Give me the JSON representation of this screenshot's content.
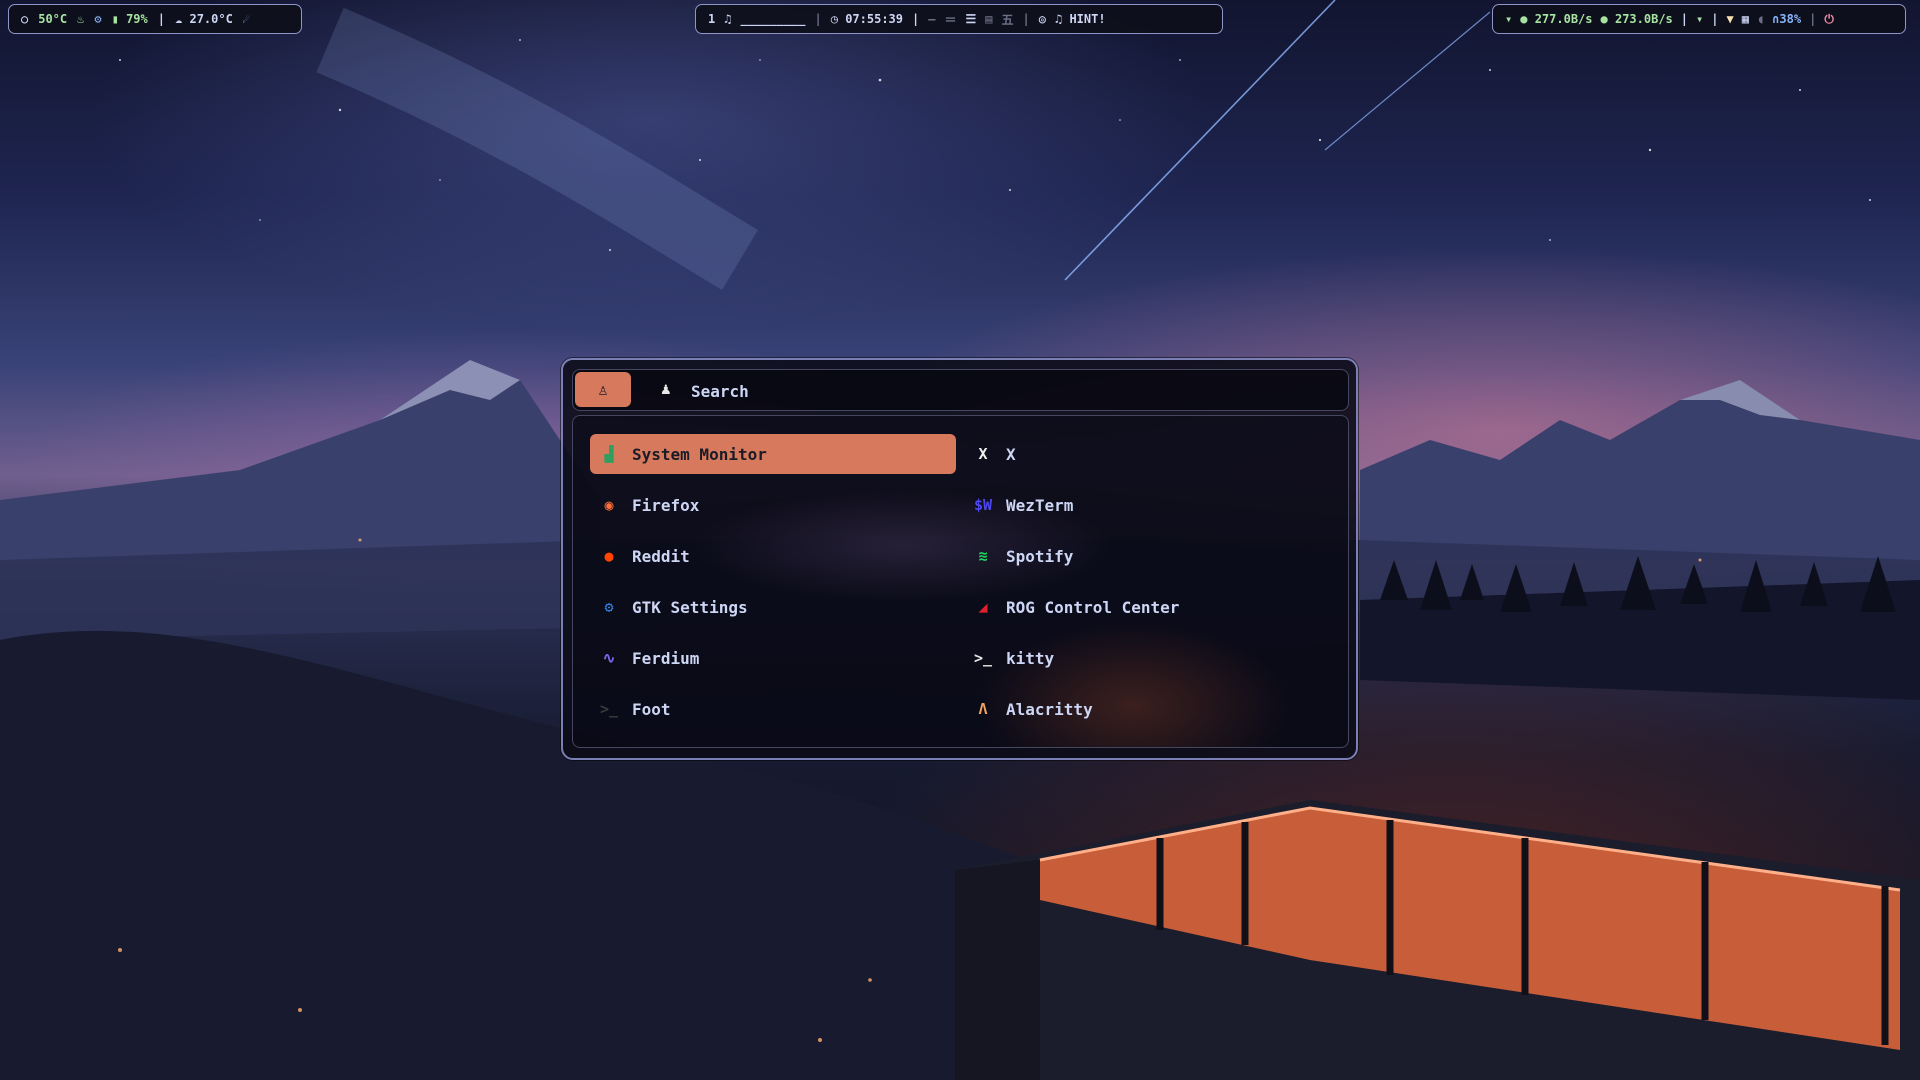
{
  "topbar": {
    "left": {
      "cpu_temp": "50°C",
      "battery": "79%",
      "weather_temp": "27.0°C"
    },
    "center": {
      "workspace": "1",
      "underline": "_________",
      "clock": "07:55:39",
      "hint": "HINT!"
    },
    "right": {
      "download": "277.0B/s",
      "upload": "273.0B/s",
      "volume": "38%"
    }
  },
  "launcher": {
    "search_label": "Search",
    "apps": [
      {
        "label": "System Monitor",
        "icon": "system-monitor-icon",
        "color": "#2e9f5f",
        "glyph": "▟",
        "active": true
      },
      {
        "label": "X",
        "icon": "x-icon",
        "color": "#f2f2f2",
        "glyph": "X",
        "active": false
      },
      {
        "label": "Firefox",
        "icon": "firefox-icon",
        "color": "#ff7139",
        "glyph": "◉",
        "active": false
      },
      {
        "label": "WezTerm",
        "icon": "wezterm-icon",
        "color": "#4e49ee",
        "glyph": "$W",
        "active": false
      },
      {
        "label": "Reddit",
        "icon": "reddit-icon",
        "color": "#ff4500",
        "glyph": "●",
        "active": false
      },
      {
        "label": "Spotify",
        "icon": "spotify-icon",
        "color": "#1ed760",
        "glyph": "≋",
        "active": false
      },
      {
        "label": "GTK Settings",
        "icon": "gtk-settings-icon",
        "color": "#3584e4",
        "glyph": "⚙",
        "active": false
      },
      {
        "label": "ROG Control Center",
        "icon": "rog-icon",
        "color": "#e0212b",
        "glyph": "◢",
        "active": false
      },
      {
        "label": "Ferdium",
        "icon": "ferdium-icon",
        "color": "#7b68ee",
        "glyph": "∿",
        "active": false
      },
      {
        "label": "kitty",
        "icon": "kitty-icon",
        "color": "#e6e6e6",
        "glyph": ">_",
        "active": false
      },
      {
        "label": "Foot",
        "icon": "foot-icon",
        "color": "#3a3a3a",
        "glyph": ">_",
        "active": false
      },
      {
        "label": "Alacritty",
        "icon": "alacritty-icon",
        "color": "#f4a261",
        "glyph": "Λ",
        "active": false
      }
    ]
  }
}
